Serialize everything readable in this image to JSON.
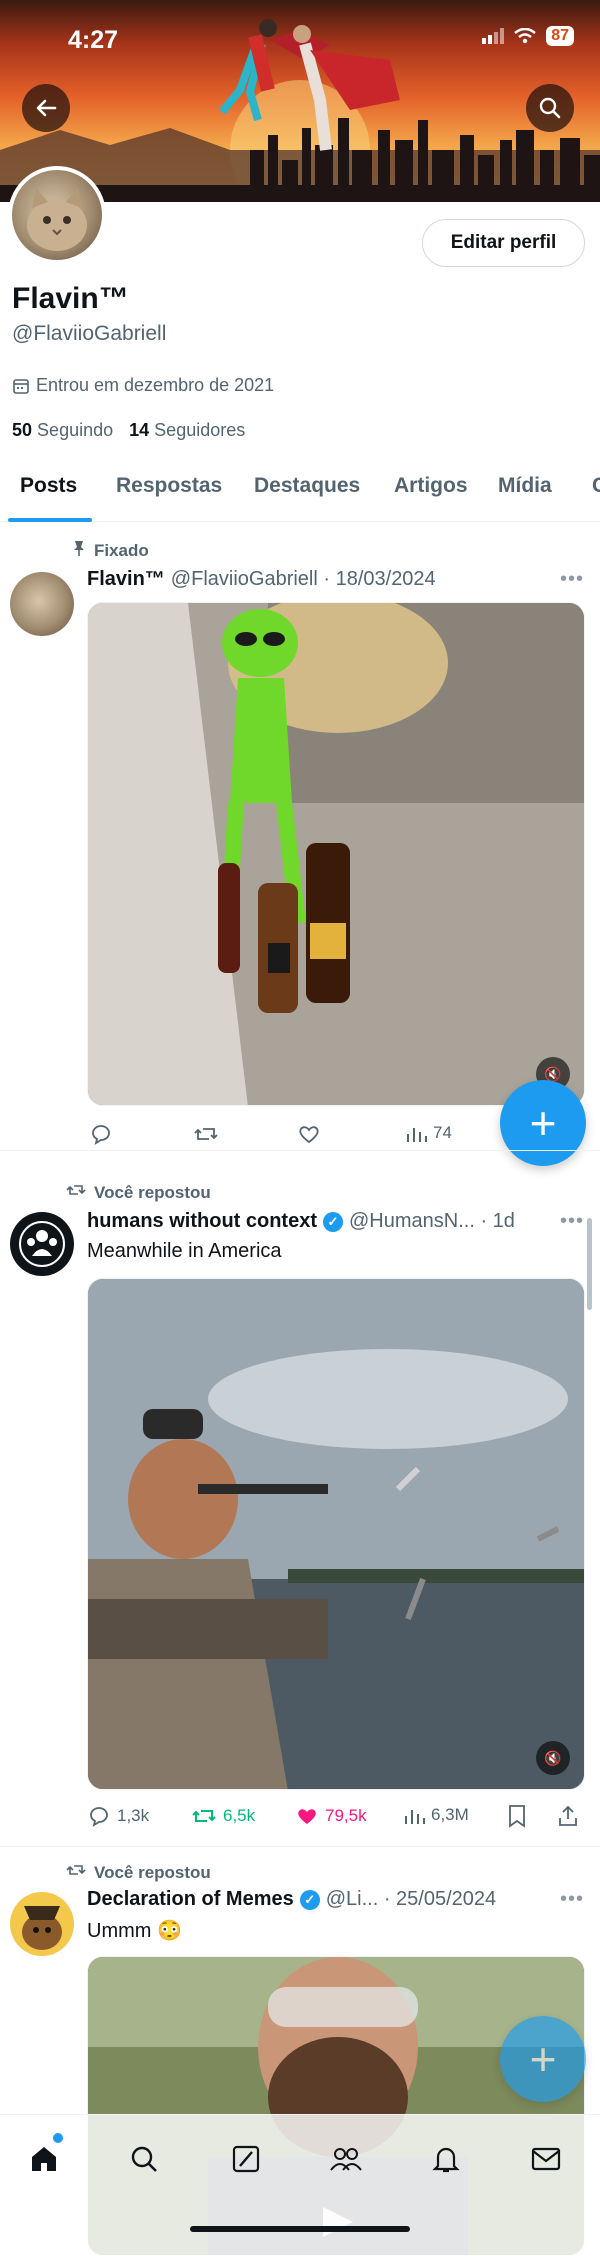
{
  "status": {
    "time": "4:27",
    "battery": "87"
  },
  "icons": {
    "back": "arrow-left-icon",
    "search": "search-icon",
    "calendar": "calendar-icon",
    "pin": "pin-icon",
    "repost": "repost-icon",
    "reply": "reply-icon",
    "like": "heart-icon",
    "views": "views-icon",
    "bookmark": "bookmark-icon",
    "share": "share-icon",
    "mute": "mute-icon",
    "more": "more-icon"
  },
  "profile": {
    "edit_label": "Editar perfil",
    "name": "Flavin™",
    "handle": "@FlaviioGabriell",
    "joined": "Entrou em dezembro de 2021",
    "following_count": "50",
    "following_label": "Seguindo",
    "followers_count": "14",
    "followers_label": "Seguidores"
  },
  "tabs": [
    {
      "label": "Posts"
    },
    {
      "label": "Respostas"
    },
    {
      "label": "Destaques"
    },
    {
      "label": "Artigos"
    },
    {
      "label": "Mídia"
    }
  ],
  "posts": [
    {
      "context": "Fixado",
      "name": "Flavin™",
      "meta": "@FlaviioGabriell · 18/03/2024",
      "actions": {
        "views": "74"
      }
    },
    {
      "context": "Você repostou",
      "name": "humans without context",
      "meta": "@HumansN... · 1d",
      "text": "Meanwhile in America",
      "actions": {
        "replies": "1,3k",
        "reposts": "6,5k",
        "likes": "79,5k",
        "views": "6,3M"
      }
    },
    {
      "context": "Você repostou",
      "name": "Declaration of Memes",
      "meta": "@Li... · 25/05/2024",
      "text": "Ummm 😳"
    }
  ],
  "colors": {
    "accent": "#1d9bf0",
    "repost_green": "#00ba7c",
    "like_pink": "#f91880"
  }
}
